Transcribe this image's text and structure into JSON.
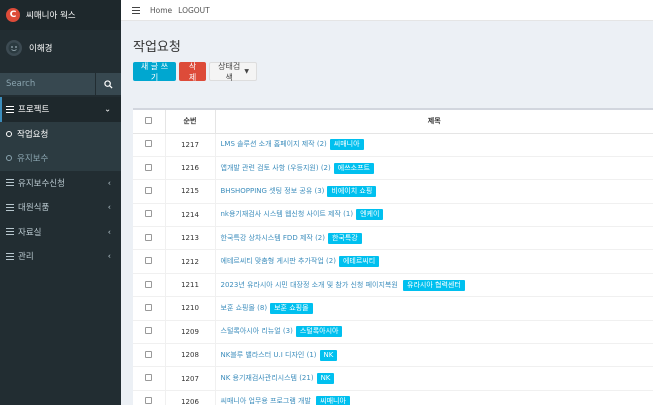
{
  "brand": {
    "logo_letter": "C",
    "name": "씨매니아 웍스"
  },
  "user": {
    "name": "이해경"
  },
  "search": {
    "placeholder": "Search"
  },
  "menu": {
    "project": "프로젝트",
    "work_request": "작업요청",
    "maintenance": "유지보수",
    "maintenance_request": "유지보수신청",
    "affiliate": "대원식품",
    "library": "자료실",
    "admin": "관리"
  },
  "topbar": {
    "home": "Home",
    "logout": "LOGOUT"
  },
  "page": {
    "title": "작업요청"
  },
  "actions": {
    "new_post": "새 글 쓰기",
    "delete": "삭제",
    "status_search": "상태검색"
  },
  "table": {
    "headers": {
      "num": "순번",
      "title": "제목"
    },
    "rows": [
      {
        "num": "1217",
        "title": "LMS 솔루션 소개 홈페이지 제작",
        "count": "(2)",
        "tag": "씨매니아"
      },
      {
        "num": "1216",
        "title": "앱개발 관련 검토 사항 (우등지원)",
        "count": "(2)",
        "tag": "에쓰소프트"
      },
      {
        "num": "1215",
        "title": "BHSHOPPING 셋팅 정보 공유",
        "count": "(3)",
        "tag": "비에이치 쇼핑"
      },
      {
        "num": "1214",
        "title": "nk용기재검사 시스템 웹신청 사이트 제작",
        "count": "(1)",
        "tag": "엔케이"
      },
      {
        "num": "1213",
        "title": "한국특강 상차시스템 FDD 제작",
        "count": "(2)",
        "tag": "한국특강"
      },
      {
        "num": "1212",
        "title": "에테르씨티 맞춤형 게시판 추가작업",
        "count": "(2)",
        "tag": "에테르씨티"
      },
      {
        "num": "1211",
        "title": "2023년 유라시아 시민 대장정 소개 및 참가 신청 페이지복원",
        "count": "",
        "tag": "유라시아 협력센터"
      },
      {
        "num": "1210",
        "title": "보훈 쇼핑몰",
        "count": "(8)",
        "tag": "보훈 쇼핑몰"
      },
      {
        "num": "1209",
        "title": "스털록아시아 리뉴얼",
        "count": "(3)",
        "tag": "스털록아시아"
      },
      {
        "num": "1208",
        "title": "NK블루 밸라스터 U.I 디자인",
        "count": "(1)",
        "tag": "NK"
      },
      {
        "num": "1207",
        "title": "NK 용기재검사관리시스템",
        "count": "(21)",
        "tag": "NK"
      },
      {
        "num": "1206",
        "title": "씨매니아 업무용 프로그램 개발",
        "count": "",
        "tag": "씨매니아"
      }
    ]
  },
  "colors": {
    "sidebar": "#222d32",
    "accent": "#3c8dbc",
    "tag": "#00c0ef",
    "new_btn": "#00a7d0",
    "delete_btn": "#dd4b39"
  }
}
